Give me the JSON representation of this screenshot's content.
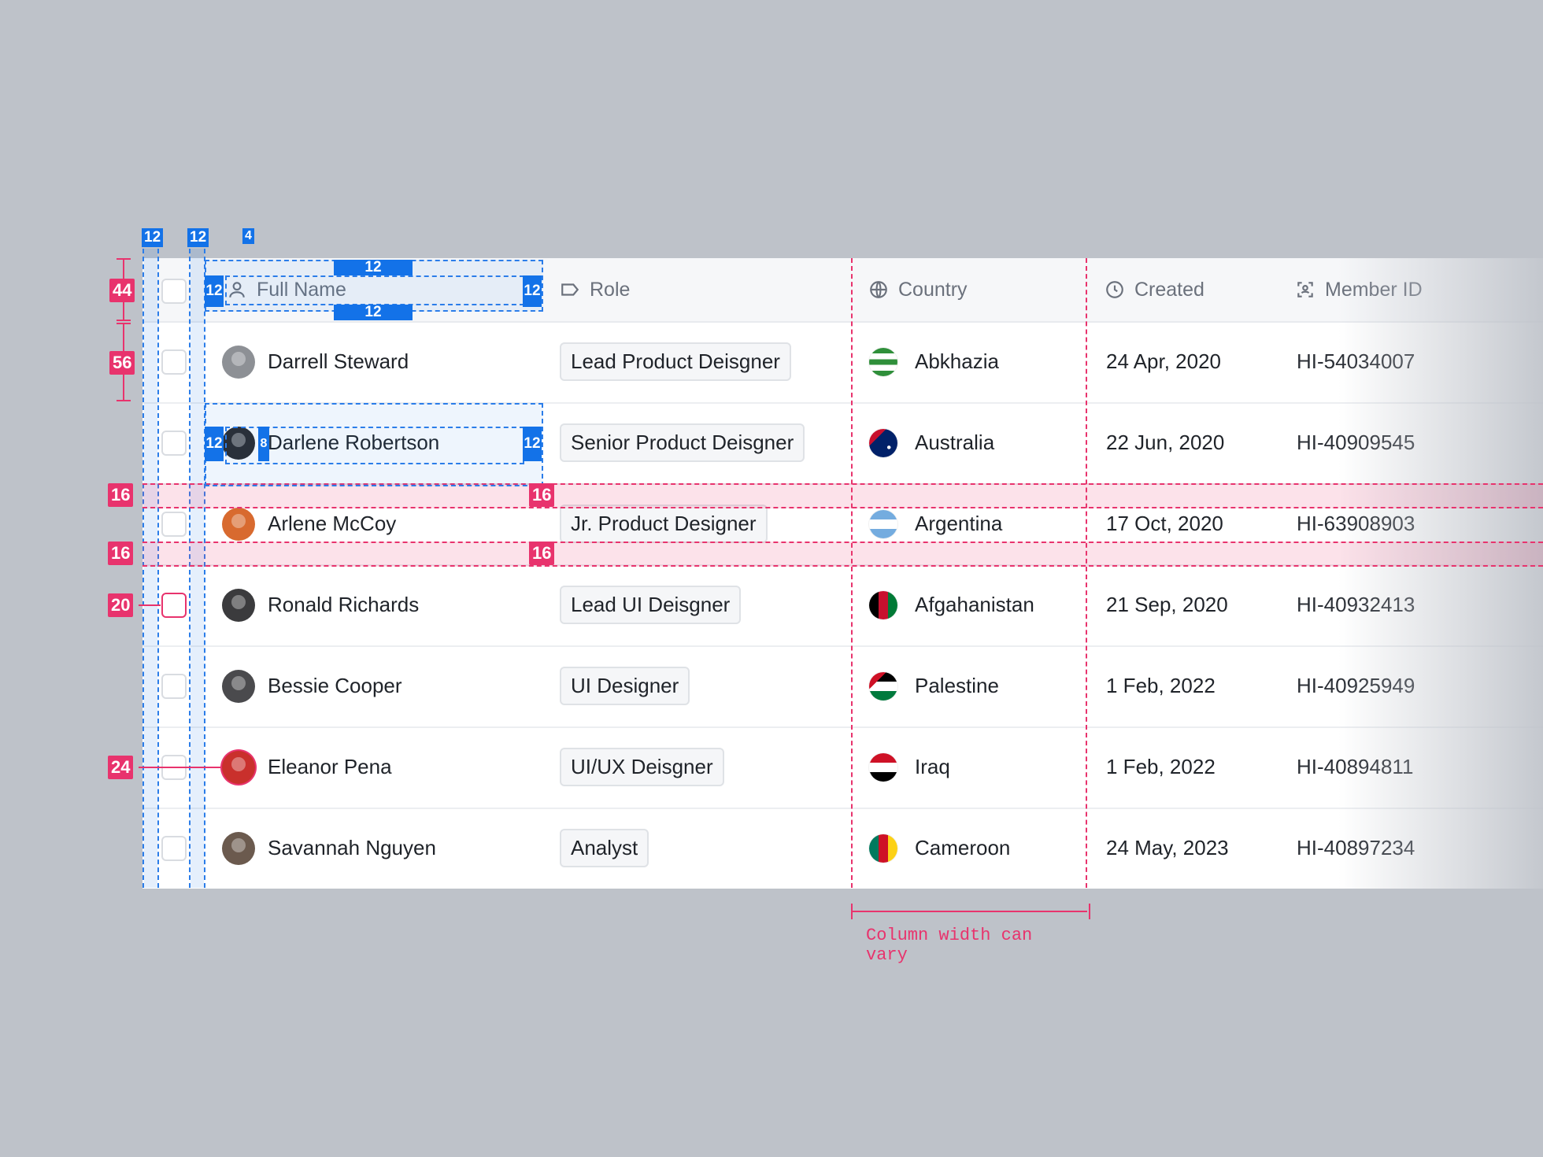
{
  "columns": {
    "full_name": "Full Name",
    "role": "Role",
    "country": "Country",
    "created": "Created",
    "member_id": "Member ID"
  },
  "rows": [
    {
      "name": "Darrell Steward",
      "role": "Lead Product Deisgner",
      "country": "Abkhazia",
      "created": "24 Apr, 2020",
      "member_id": "HI-54034007"
    },
    {
      "name": "Darlene Robertson",
      "role": "Senior Product Deisgner",
      "country": "Australia",
      "created": "22 Jun, 2020",
      "member_id": "HI-40909545"
    },
    {
      "name": "Arlene McCoy",
      "role": "Jr. Product Designer",
      "country": "Argentina",
      "created": "17 Oct, 2020",
      "member_id": "HI-63908903"
    },
    {
      "name": "Ronald Richards",
      "role": "Lead UI Deisgner",
      "country": "Afgahanistan",
      "created": "21 Sep, 2020",
      "member_id": "HI-40932413"
    },
    {
      "name": "Bessie Cooper",
      "role": "UI Designer",
      "country": "Palestine",
      "created": "1 Feb, 2022",
      "member_id": "HI-40925949"
    },
    {
      "name": "Eleanor Pena",
      "role": "UI/UX Deisgner",
      "country": "Iraq",
      "created": "1 Feb, 2022",
      "member_id": "HI-40894811"
    },
    {
      "name": "Savannah Nguyen",
      "role": "Analyst",
      "country": "Cameroon",
      "created": "24 May, 2023",
      "member_id": "HI-40897234"
    }
  ],
  "annotations": {
    "header_height": "44",
    "row_height": "56",
    "checkbox_size": "20",
    "avatar_size": "24",
    "row_gap": "16",
    "col_padding": "12",
    "icon_gap": "4",
    "avatar_gap": "8",
    "caption": "Column width can vary"
  },
  "colors": {
    "annotation_blue": "#1372e8",
    "annotation_pink": "#e8336d",
    "background": "#bec2c9"
  }
}
